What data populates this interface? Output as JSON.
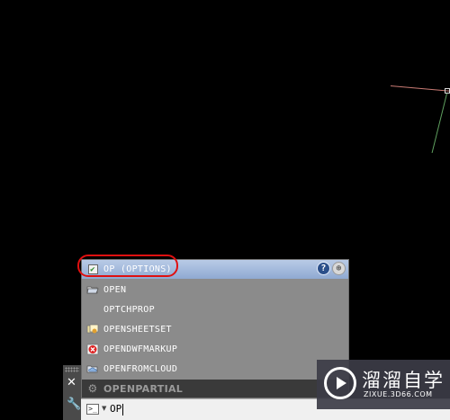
{
  "autocomplete": {
    "items": [
      {
        "label": "OP (OPTIONS)",
        "icon": "checkbox-icon"
      },
      {
        "label": "OPEN",
        "icon": "open-folder-icon"
      },
      {
        "label": "OPTCHPROP",
        "icon": ""
      },
      {
        "label": "OPENSHEETSET",
        "icon": "sheetset-icon"
      },
      {
        "label": "OPENDWFMARKUP",
        "icon": "dwf-markup-icon"
      },
      {
        "label": "OPENFROMCLOUD",
        "icon": "cloud-open-icon"
      },
      {
        "label": "OPENPARTIAL",
        "icon": "gear-icon"
      }
    ],
    "help_glyph": "?",
    "globe_glyph": "⊕"
  },
  "command_line": {
    "prompt_glyph": ">_",
    "value": "OP"
  },
  "watermark": {
    "title": "溜溜自学",
    "subtitle": "ZIXUE.3D66.COM"
  },
  "colors": {
    "canvas": "#000000",
    "highlight_border": "#e01010",
    "x_axis": "#c97b74",
    "y_axis": "#5fa05f"
  }
}
